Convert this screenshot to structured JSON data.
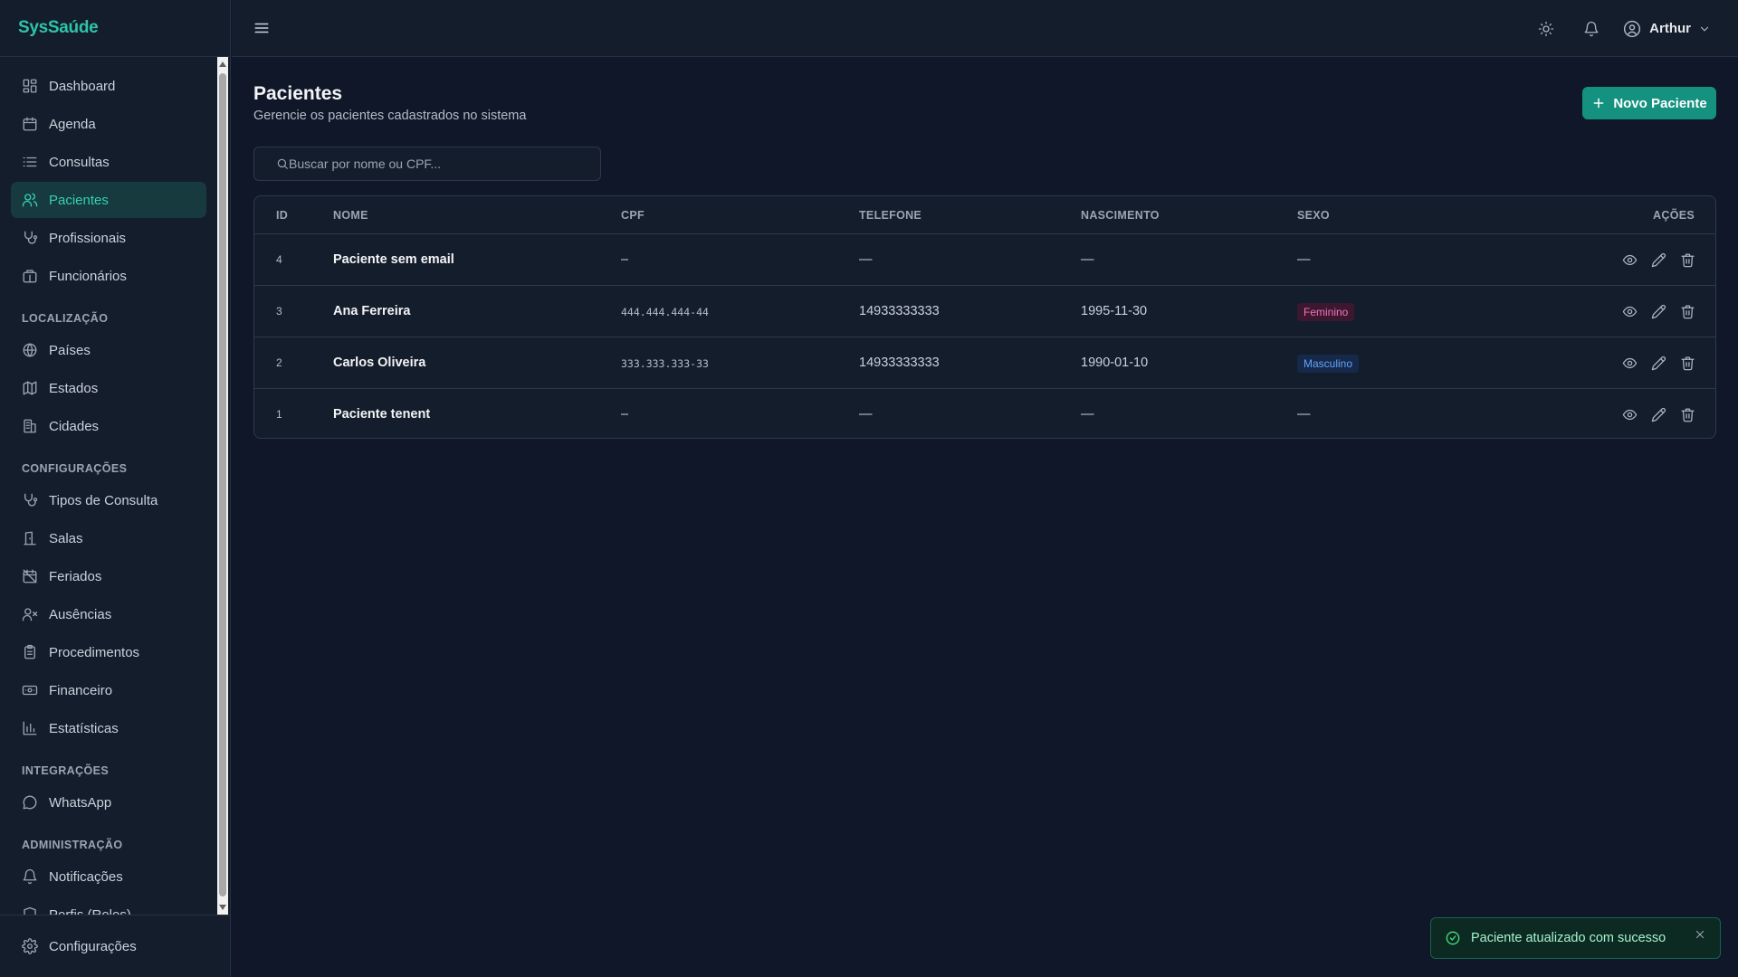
{
  "app": {
    "brand": "SysSaúde"
  },
  "sidebar": {
    "groups": [
      {
        "title": "",
        "items": [
          {
            "label": "Dashboard",
            "icon": "dashboard-icon",
            "active": false
          },
          {
            "label": "Agenda",
            "icon": "calendar-icon",
            "active": false
          },
          {
            "label": "Consultas",
            "icon": "list-icon",
            "active": false
          },
          {
            "label": "Pacientes",
            "icon": "users-icon",
            "active": true
          },
          {
            "label": "Profissionais",
            "icon": "stethoscope-icon",
            "active": false
          },
          {
            "label": "Funcionários",
            "icon": "briefcase-icon",
            "active": false
          }
        ]
      },
      {
        "title": "LOCALIZAÇÃO",
        "items": [
          {
            "label": "Países",
            "icon": "globe-icon",
            "active": false
          },
          {
            "label": "Estados",
            "icon": "map-icon",
            "active": false
          },
          {
            "label": "Cidades",
            "icon": "building-icon",
            "active": false
          }
        ]
      },
      {
        "title": "CONFIGURAÇÕES",
        "items": [
          {
            "label": "Tipos de Consulta",
            "icon": "stethoscope-icon",
            "active": false
          },
          {
            "label": "Salas",
            "icon": "door-icon",
            "active": false
          },
          {
            "label": "Feriados",
            "icon": "calendar-off-icon",
            "active": false
          },
          {
            "label": "Ausências",
            "icon": "user-x-icon",
            "active": false
          },
          {
            "label": "Procedimentos",
            "icon": "clipboard-icon",
            "active": false
          },
          {
            "label": "Financeiro",
            "icon": "banknote-icon",
            "active": false
          },
          {
            "label": "Estatísticas",
            "icon": "chart-icon",
            "active": false
          }
        ]
      },
      {
        "title": "INTEGRAÇÕES",
        "items": [
          {
            "label": "WhatsApp",
            "icon": "message-circle-icon",
            "active": false
          }
        ]
      },
      {
        "title": "ADMINISTRAÇÃO",
        "items": [
          {
            "label": "Notificações",
            "icon": "bell-icon",
            "active": false
          },
          {
            "label": "Perfis (Roles)",
            "icon": "shield-icon",
            "active": false
          }
        ]
      }
    ],
    "footer": {
      "label": "Configurações",
      "icon": "gear-icon"
    }
  },
  "topbar": {
    "user_name": "Arthur"
  },
  "page": {
    "title": "Pacientes",
    "subtitle": "Gerencie os pacientes cadastrados no sistema",
    "new_button_label": "Novo Paciente",
    "search_placeholder": "Buscar por nome ou CPF..."
  },
  "table": {
    "columns": [
      "ID",
      "NOME",
      "CPF",
      "TELEFONE",
      "NASCIMENTO",
      "SEXO",
      "AÇÕES"
    ],
    "rows": [
      {
        "id": "4",
        "name": "Paciente sem email",
        "cpf": "–",
        "phone": "—",
        "birth": "—",
        "sex": "—",
        "sex_kind": "none"
      },
      {
        "id": "3",
        "name": "Ana Ferreira",
        "cpf": "444.444.444-44",
        "phone": "14933333333",
        "birth": "1995-11-30",
        "sex": "Feminino",
        "sex_kind": "fem"
      },
      {
        "id": "2",
        "name": "Carlos Oliveira",
        "cpf": "333.333.333-33",
        "phone": "14933333333",
        "birth": "1990-01-10",
        "sex": "Masculino",
        "sex_kind": "masc"
      },
      {
        "id": "1",
        "name": "Paciente tenent",
        "cpf": "–",
        "phone": "—",
        "birth": "—",
        "sex": "—",
        "sex_kind": "none"
      }
    ]
  },
  "toast": {
    "message": "Paciente atualizado com sucesso"
  },
  "colors": {
    "accent": "#14917f",
    "active_nav": "#34d1b3",
    "brand": "#2ec4a8"
  }
}
